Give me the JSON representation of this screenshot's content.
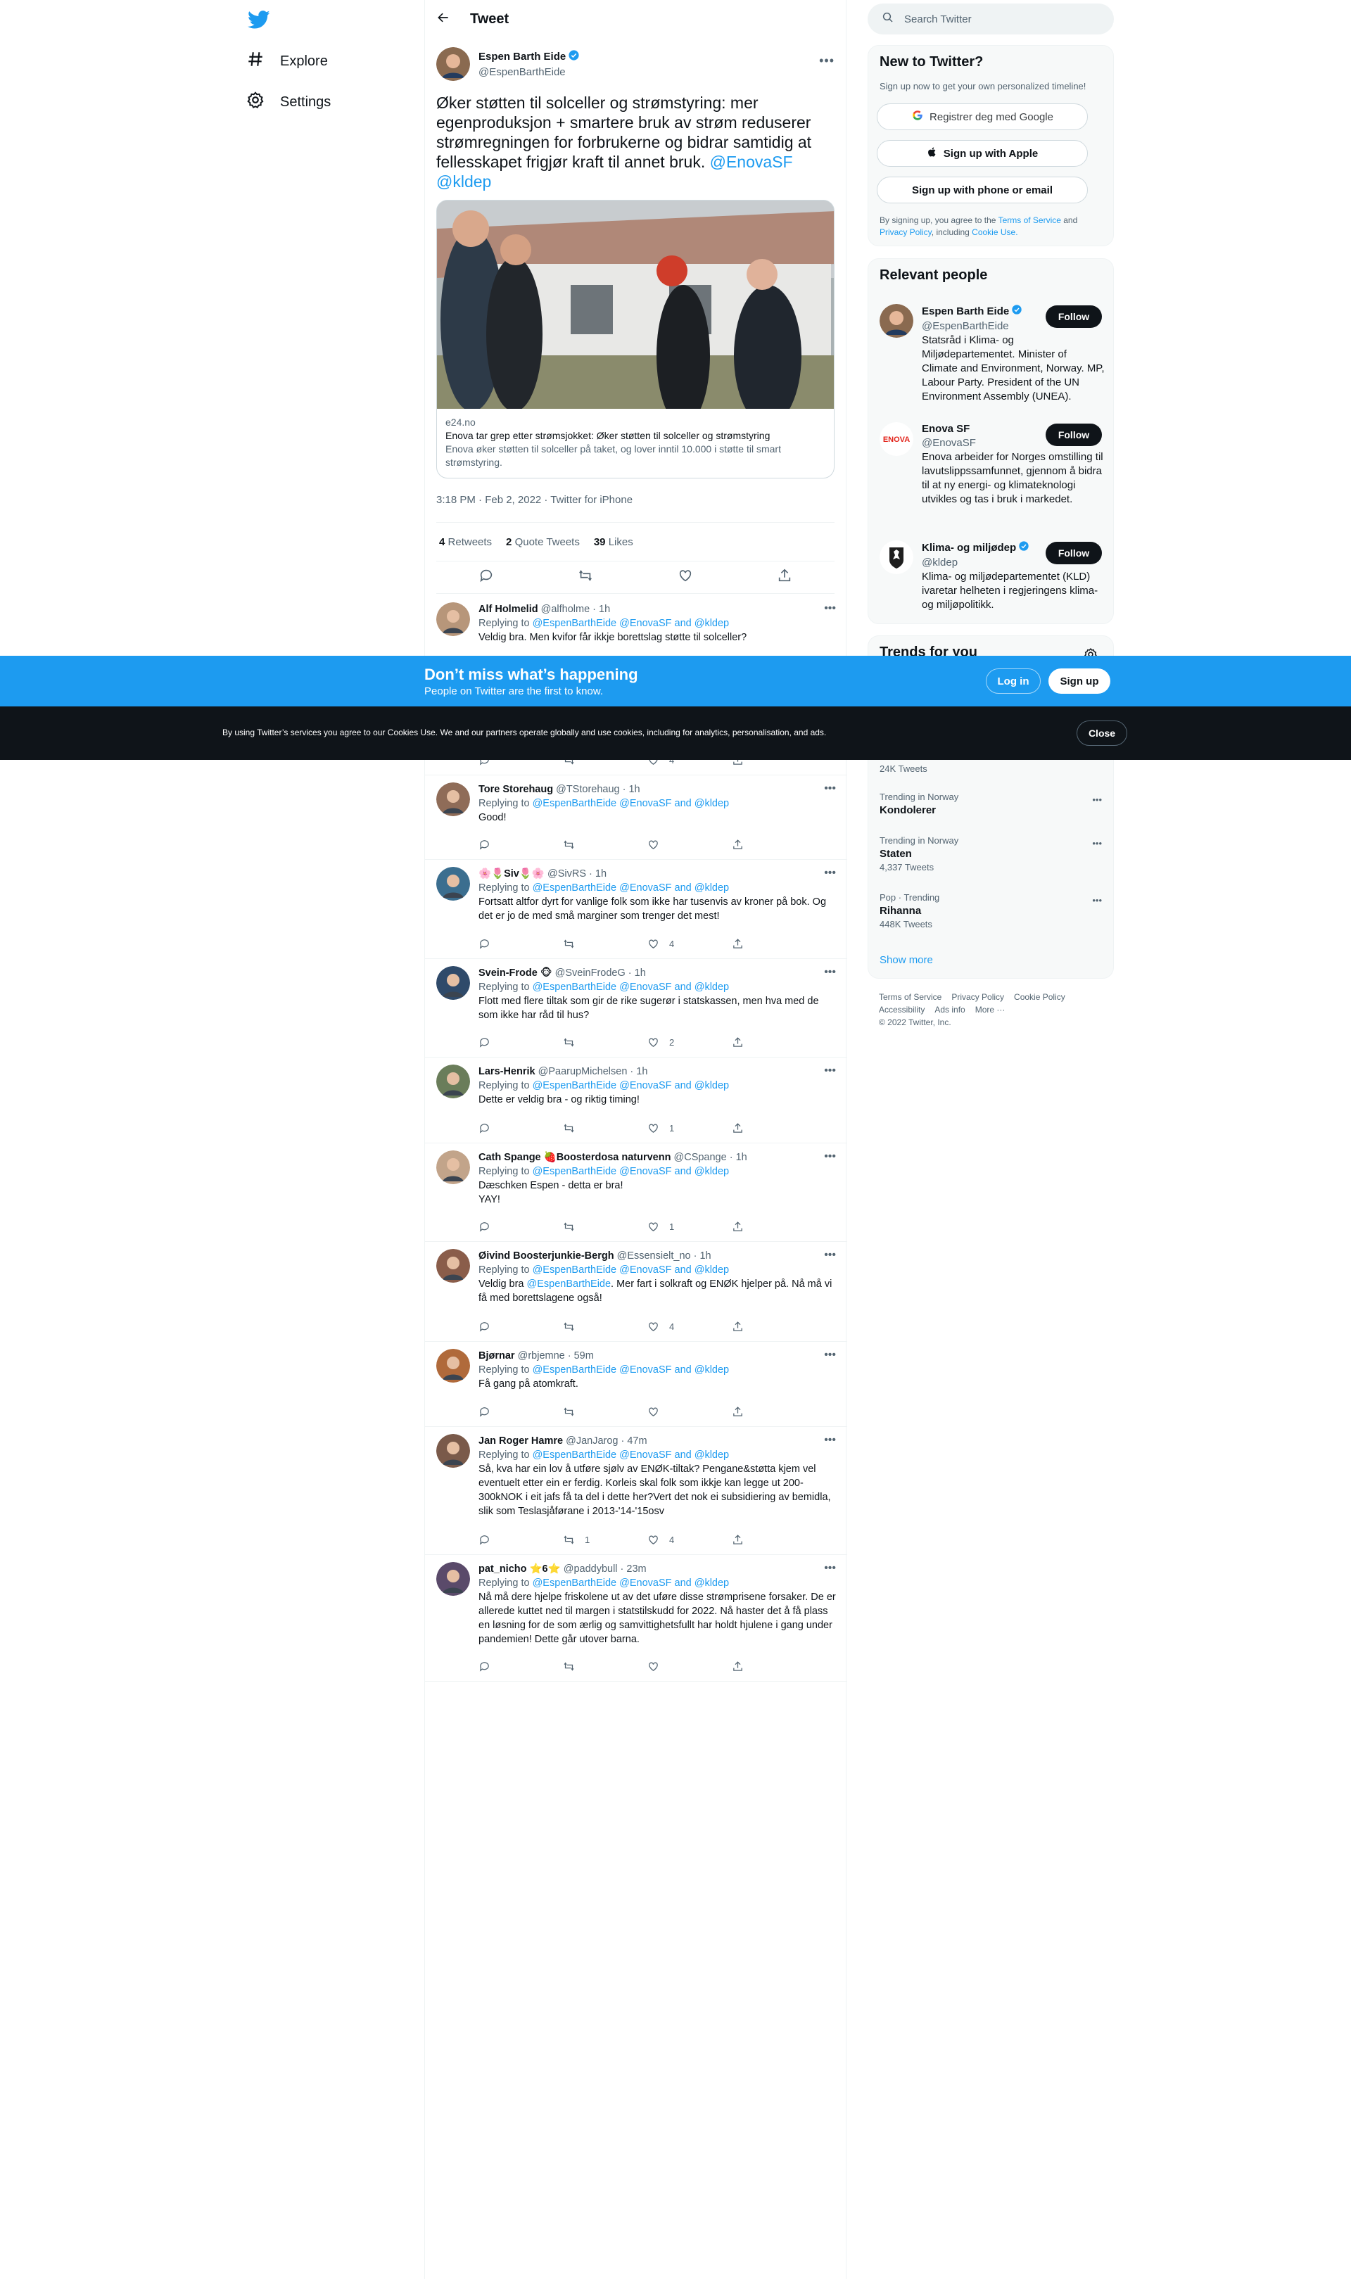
{
  "nav": {
    "explore": "Explore",
    "settings": "Settings"
  },
  "header": {
    "title": "Tweet"
  },
  "tweet": {
    "author_name": "Espen Barth Eide",
    "author_handle": "@EspenBarthEide",
    "text_main": "Øker støtten til solceller og strømstyring: mer egenproduksjon + smartere bruk av strøm reduserer strømregningen for forbrukerne og bidrar samtidig at fellesskapet frigjør kraft til annet bruk. ",
    "mention1": "@EnovaSF",
    "mention2": "@kldep",
    "card": {
      "domain": "e24.no",
      "title": "Enova tar grep etter strømsjokket: Øker støtten til solceller og strømstyring",
      "description": "Enova øker støtten til solceller på taket, og lover inntil 10.000 i støtte til smart strømstyring."
    },
    "timestamp": "3:18 PM · Feb 2, 2022 · Twitter for iPhone",
    "retweets": "4",
    "retweets_label": "Retweets",
    "quotes": "2",
    "quotes_label": "Quote Tweets",
    "likes": "39",
    "likes_label": "Likes"
  },
  "replying_to_label": "Replying to",
  "reply_mentions": "@EspenBarthEide @EnovaSF and @kldep",
  "replies": [
    {
      "name": "Alf Holmelid",
      "handle": "@alfholme · 1h",
      "text": "Veldig bra. Men kvifor får ikkje borettslag støtte til solceller?",
      "retweets": "",
      "likes": ""
    },
    {
      "name": "",
      "handle": "",
      "text": "",
      "retweets": "",
      "likes": "4"
    },
    {
      "name": "Tore Storehaug",
      "handle": "@TStorehaug · 1h",
      "text": "Good!",
      "retweets": "",
      "likes": ""
    },
    {
      "name": "🌸🌷Siv🌷🌸",
      "handle": "@SivRS · 1h",
      "text": "Fortsatt altfor dyrt for vanlige folk som ikke har tusenvis av kroner på bok. Og det er jo de med små marginer som trenger det mest!",
      "retweets": "",
      "likes": "4"
    },
    {
      "name": "Svein-Frode 🐵",
      "handle": "@SveinFrodeG · 1h",
      "text": "Flott med flere tiltak som gir de rike sugerør i statskassen, men hva med de som ikke har råd til hus?",
      "retweets": "",
      "likes": "2"
    },
    {
      "name": "Lars-Henrik",
      "handle": "@PaarupMichelsen · 1h",
      "text": "Dette er veldig bra - og riktig timing!",
      "retweets": "",
      "likes": "1"
    },
    {
      "name": "Cath Spange 🍓Boosterdosa naturvenn",
      "handle": "@CSpange · 1h",
      "text": "Dæschken Espen - detta er bra!\nYAY!",
      "retweets": "",
      "likes": "1"
    },
    {
      "name": "Øivind Boosterjunkie-Bergh",
      "handle": "@Essensielt_no · 1h",
      "text": "",
      "text_pre": "Veldig bra ",
      "text_mention": "@EspenBarthEide",
      "text_post": ". Mer fart i solkraft og ENØK hjelper på. Nå må vi få med borettslagene også!",
      "retweets": "",
      "likes": "4"
    },
    {
      "name": "Bjørnar",
      "handle": "@rbjemne · 59m",
      "text": "Få gang på atomkraft.",
      "retweets": "",
      "likes": ""
    },
    {
      "name": "Jan Roger Hamre",
      "handle": "@JanJarog · 47m",
      "text": "Så, kva har ein lov å utføre sjølv av ENØK-tiltak? Pengane&støtta kjem vel eventuelt etter ein er ferdig. Korleis skal folk som ikkje kan legge ut 200-300kNOK i eit jafs få ta del i dette her?Vert det nok ei subsidiering av bemidla, slik som Teslasjåførane i 2013-'14-'15osv",
      "retweets": "1",
      "likes": "4"
    },
    {
      "name": "pat_nicho ⭐6⭐",
      "handle": "@paddybull · 23m",
      "text": "Nå må dere hjelpe friskolene ut av det uføre disse strømprisene forsaker. De er allerede kuttet ned til margen i statstilskudd for 2022. Nå haster det å få plass en løsning for de som ærlig og samvittighetsfullt har holdt hjulene i gang under pandemien! Dette går utover barna.",
      "retweets": "",
      "likes": ""
    }
  ],
  "search": {
    "placeholder": "Search Twitter"
  },
  "new_to_twitter": {
    "title": "New to Twitter?",
    "subtitle": "Sign up now to get your own personalized timeline!",
    "google": "Registrer deg med Google",
    "apple": "Sign up with Apple",
    "phone": "Sign up with phone or email",
    "legal_pre": "By signing up, you agree to the ",
    "terms": "Terms of Service",
    "legal_and": " and ",
    "privacy": "Privacy Policy",
    "legal_incl": ", including ",
    "cookie": "Cookie Use."
  },
  "relevant": {
    "title": "Relevant people",
    "follow": "Follow",
    "people": [
      {
        "name": "Espen Barth Eide",
        "handle": "@EspenBarthEide",
        "bio": "Statsråd i Klima- og Miljødepartementet. Minister of Climate and Environment, Norway. MP, Labour Party. President of the UN Environment Assembly (UNEA)."
      },
      {
        "name": "Enova SF",
        "handle": "@EnovaSF",
        "bio": "Enova arbeider for Norges omstilling til lavutslippssamfunnet, gjennom å bidra til at ny energi- og klimateknologi utvikles og tas i bruk i markedet."
      },
      {
        "name": "Klima- og miljødep",
        "handle": "@kldep",
        "bio": "Klima- og miljødepartementet (KLD) ivaretar helheten i regjeringens klima- og miljøpolitikk."
      }
    ]
  },
  "trends": {
    "title": "Trends for you",
    "items": [
      {
        "context": "",
        "name": "",
        "count": "24K Tweets"
      },
      {
        "context": "Trending in Norway",
        "name": "Kondolerer",
        "count": ""
      },
      {
        "context": "Trending in Norway",
        "name": "Staten",
        "count": "4,337 Tweets"
      },
      {
        "context": "Pop · Trending",
        "name": "Rihanna",
        "count": "448K Tweets"
      }
    ],
    "show_more": "Show more"
  },
  "footer": {
    "terms": "Terms of Service",
    "privacy": "Privacy Policy",
    "cookie": "Cookie Policy",
    "accessibility": "Accessibility",
    "ads": "Ads info",
    "more": "More ···",
    "copyright": "© 2022 Twitter, Inc."
  },
  "banner": {
    "title": "Don’t miss what’s happening",
    "subtitle": "People on Twitter are the first to know.",
    "login": "Log in",
    "signup": "Sign up"
  },
  "cookie_banner": {
    "text": "By using Twitter’s services you agree to our Cookies Use. We and our partners operate globally and use cookies, including for analytics, personalisation, and ads.",
    "close": "Close"
  },
  "colors": {
    "accent": "#1d9bf0",
    "text": "#0f1419",
    "muted": "#536471",
    "dark": "#0f1419"
  }
}
